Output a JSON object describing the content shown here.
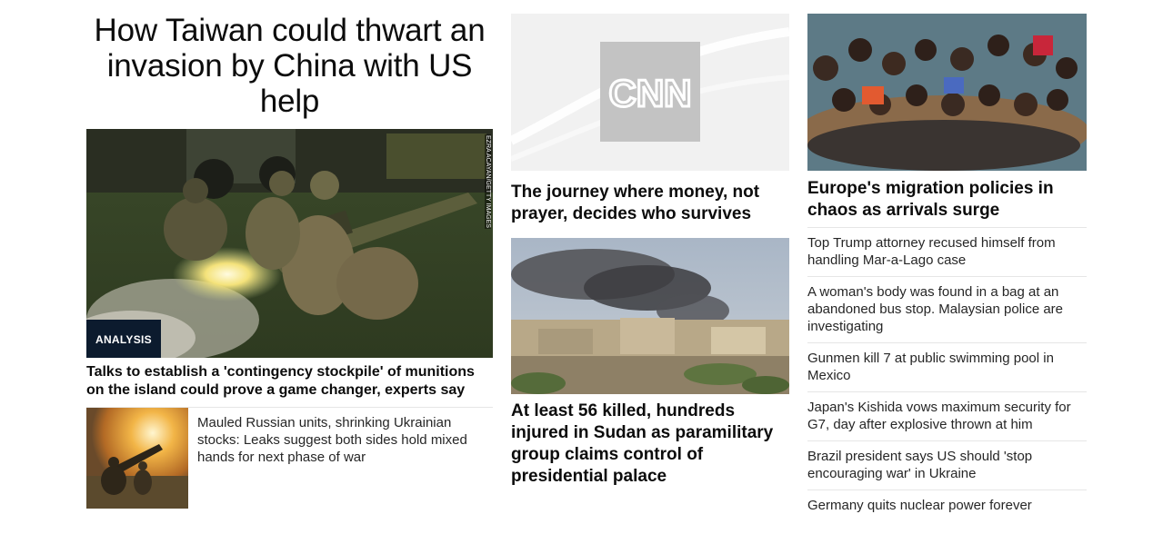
{
  "col1": {
    "main_headline": "How Taiwan could thwart an invasion by China with US help",
    "hero": {
      "badge": "ANALYSIS",
      "credit": "EZRA ACAYAN/GETTY IMAGES",
      "caption": "Talks to establish a 'contingency stockpile' of munitions on the island could prove a game changer, experts say"
    },
    "secondary": {
      "text": "Mauled Russian units, shrinking Ukrainian stocks: Leaks suggest both sides hold mixed hands for next phase of war"
    }
  },
  "col2": {
    "cnn_logo_text": "CNN",
    "first_caption": "The journey where money, not prayer, decides who survives",
    "second_caption": "At least 56 killed, hundreds injured in Sudan as paramilitary group claims control of presidential palace"
  },
  "col3": {
    "caption": "Europe's migration policies in chaos as arrivals surge",
    "headlines": [
      "Top Trump attorney recused himself from handling Mar-a-Lago case",
      "A woman's body was found in a bag at an abandoned bus stop. Malaysian police are investigating",
      "Gunmen kill 7 at public swimming pool in Mexico",
      "Japan's Kishida vows maximum security for G7, day after explosive thrown at him",
      "Brazil president says US should 'stop encouraging war' in Ukraine",
      "Germany quits nuclear power forever"
    ]
  },
  "colors": {
    "badge_bg": "#0c1b2e",
    "text": "#0c0c0c",
    "divider": "#e6e6e6"
  }
}
